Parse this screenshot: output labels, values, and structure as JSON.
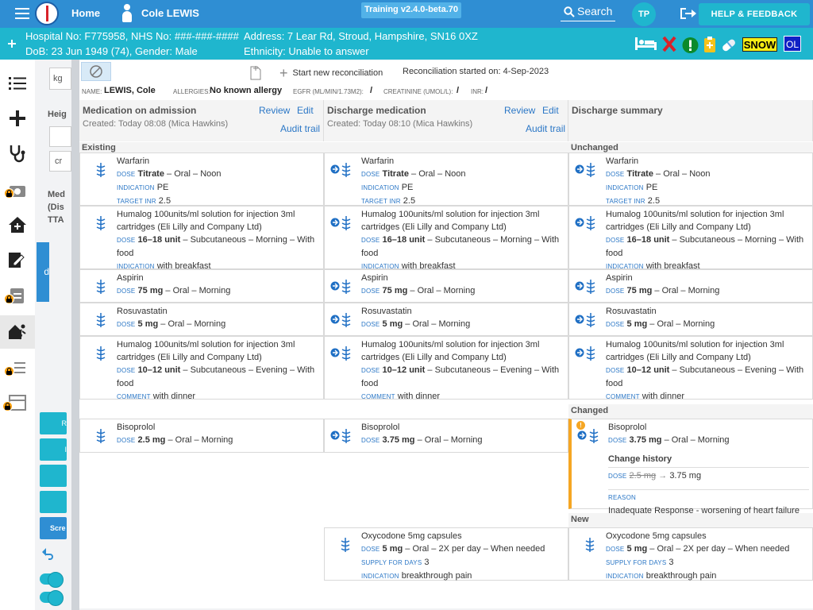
{
  "header": {
    "home": "Home",
    "patient_name": "Cole LEWIS",
    "version": "Training v2.4.0-beta.70",
    "search": "Search",
    "user_initials": "TP",
    "help": "HELP & FEEDBACK"
  },
  "patient_bar": {
    "hospital_no": "Hospital No: F775958, NHS No: ###-###-####",
    "address": "Address: 7 Lear Rd, Stroud, Hampshire, SN16 0XZ",
    "dob": "DoB: 23 Jun 1949 (74), Gender: Male",
    "ethnicity": "Ethnicity: Unable to answer",
    "badges": {
      "snow": "SNOW",
      "ol": "OL"
    }
  },
  "colors": {
    "primary": "#2f8ed3",
    "teal": "#1fb6ce",
    "link": "#2b77c6",
    "warning": "#f5a623",
    "danger": "#d8232a"
  },
  "background_form": {
    "frag1": "kg",
    "frag2": "Heig",
    "frag3": "cr",
    "frag4": "Med",
    "frag5": "(Dis",
    "frag6": "TTA",
    "frag7": "d",
    "btn1": "R",
    "btn2": "I",
    "btn3": "Scre"
  },
  "toolbar": {
    "start_new": "Start new reconciliation",
    "started": "Reconciliation started on: 4-Sep-2023"
  },
  "patient_info": {
    "name_label": "NAME:",
    "name": "LEWIS, Cole",
    "allergies_label": "ALLERGIES:",
    "allergies": "No known allergy",
    "egfr_label": "EGFR (ML/MIN/1.73M2):",
    "egfr": "/",
    "creat_label": "CREATININE (UMOL/L):",
    "creat": "/",
    "inr_label": "INR:",
    "inr": "/"
  },
  "columns": {
    "admission": {
      "title": "Medication on admission",
      "review": "Review",
      "edit": "Edit",
      "created": "Created: Today 08:08 (Mica Hawkins)",
      "audit": "Audit trail"
    },
    "discharge": {
      "title": "Discharge medication",
      "review": "Review",
      "edit": "Edit",
      "created": "Created: Today 08:10 (Mica Hawkins)",
      "audit": "Audit trail"
    },
    "summary": {
      "title": "Discharge summary"
    }
  },
  "sections": {
    "existing": "Existing",
    "unchanged": "Unchanged",
    "changed": "Changed",
    "new": "New"
  },
  "labels": {
    "dose": "DOSE",
    "indication": "INDICATION",
    "target_inr": "TARGET INR",
    "comment": "COMMENT",
    "supply": "SUPPLY FOR DAYS",
    "reason": "REASON"
  },
  "meds": {
    "warfarin": {
      "name": "Warfarin",
      "dose": "Titrate",
      "route": " – Oral – Noon",
      "indication": "PE",
      "target": "2.5"
    },
    "humalog1": {
      "name": "Humalog 100units/ml solution for injection 3ml cartridges (Eli Lilly and Company Ltd)",
      "dose": "16–18 unit",
      "route": " – Subcutaneous – Morning – With food",
      "indication": "with breakfast"
    },
    "aspirin": {
      "name": "Aspirin",
      "dose": "75 mg",
      "route": " – Oral – Morning"
    },
    "rosuvastatin": {
      "name": "Rosuvastatin",
      "dose": "5 mg",
      "route": " – Oral – Morning"
    },
    "humalog2": {
      "name": "Humalog 100units/ml solution for injection 3ml cartridges (Eli Lilly and Company Ltd)",
      "dose": "10–12 unit",
      "route": " – Subcutaneous – Evening – With food",
      "comment": "with dinner"
    },
    "bisoprolol_adm": {
      "name": "Bisoprolol",
      "dose": "2.5 mg",
      "route": " – Oral – Morning"
    },
    "bisoprolol_dis": {
      "name": "Bisoprolol",
      "dose": "3.75 mg",
      "route": " – Oral – Morning"
    },
    "oxycodone": {
      "name": "Oxycodone 5mg capsules",
      "dose": "5 mg",
      "route": " – Oral – 2X per day – When needed",
      "supply": "3",
      "indication": "breakthrough pain"
    }
  },
  "change_history": {
    "title": "Change history",
    "old": "2.5 mg",
    "new": "3.75 mg",
    "reason": "Inadequate Response - worsening of heart failure"
  }
}
